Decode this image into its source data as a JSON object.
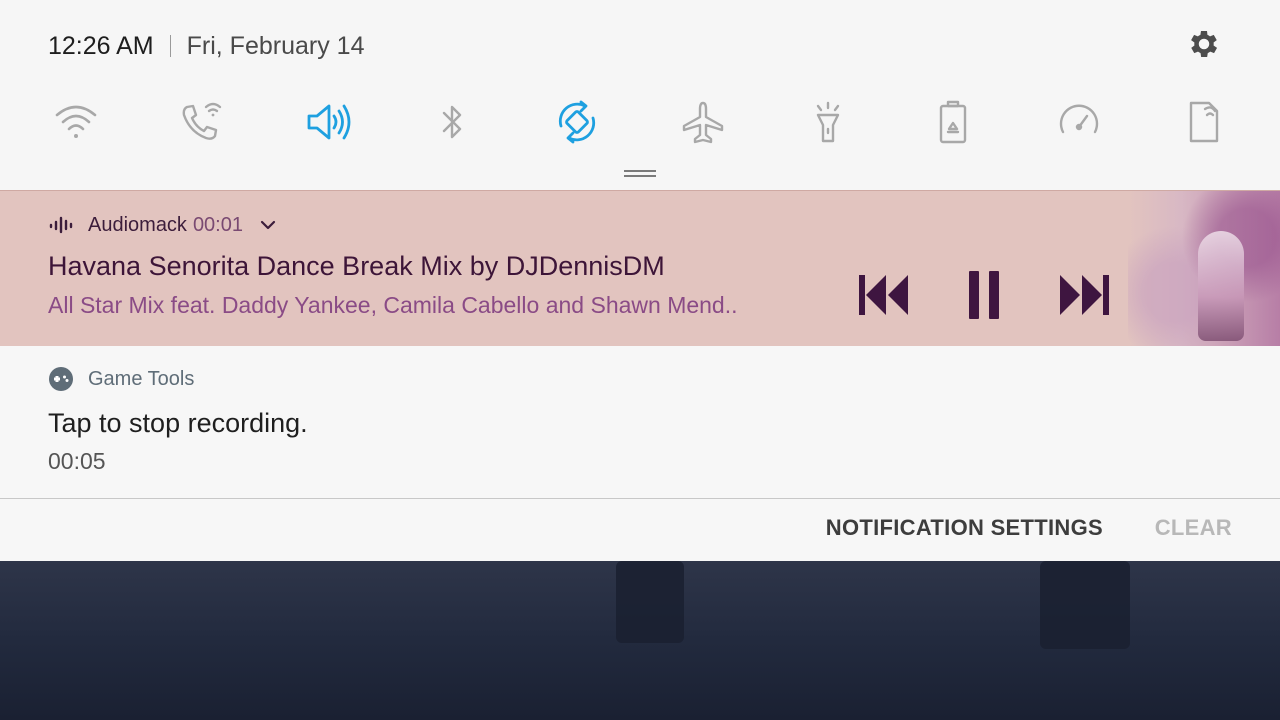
{
  "status": {
    "time": "12:26 AM",
    "date": "Fri, February 14"
  },
  "quick_settings": [
    {
      "name": "wifi-icon",
      "active": false
    },
    {
      "name": "wifi-calling-icon",
      "active": false
    },
    {
      "name": "sound-icon",
      "active": true
    },
    {
      "name": "bluetooth-icon",
      "active": false
    },
    {
      "name": "auto-rotate-icon",
      "active": true
    },
    {
      "name": "airplane-mode-icon",
      "active": false
    },
    {
      "name": "flashlight-icon",
      "active": false
    },
    {
      "name": "power-saving-icon",
      "active": false
    },
    {
      "name": "performance-icon",
      "active": false
    },
    {
      "name": "secure-folder-icon",
      "active": false
    }
  ],
  "colors": {
    "active_icon": "#1ea0e0",
    "inactive_icon": "#a8a8a8",
    "media_bg": "#e2c4bf",
    "media_control": "#3e1540"
  },
  "media": {
    "app_name": "Audiomack",
    "elapsed": "00:01",
    "title": "Havana Senorita Dance Break Mix by DJDennisDM",
    "artist": "All Star Mix feat. Daddy Yankee, Camila Cabello and Shawn Mend.."
  },
  "game_tools": {
    "app_name": "Game Tools",
    "title": "Tap to stop recording.",
    "elapsed": "00:05"
  },
  "footer": {
    "settings_label": "NOTIFICATION SETTINGS",
    "clear_label": "CLEAR"
  }
}
